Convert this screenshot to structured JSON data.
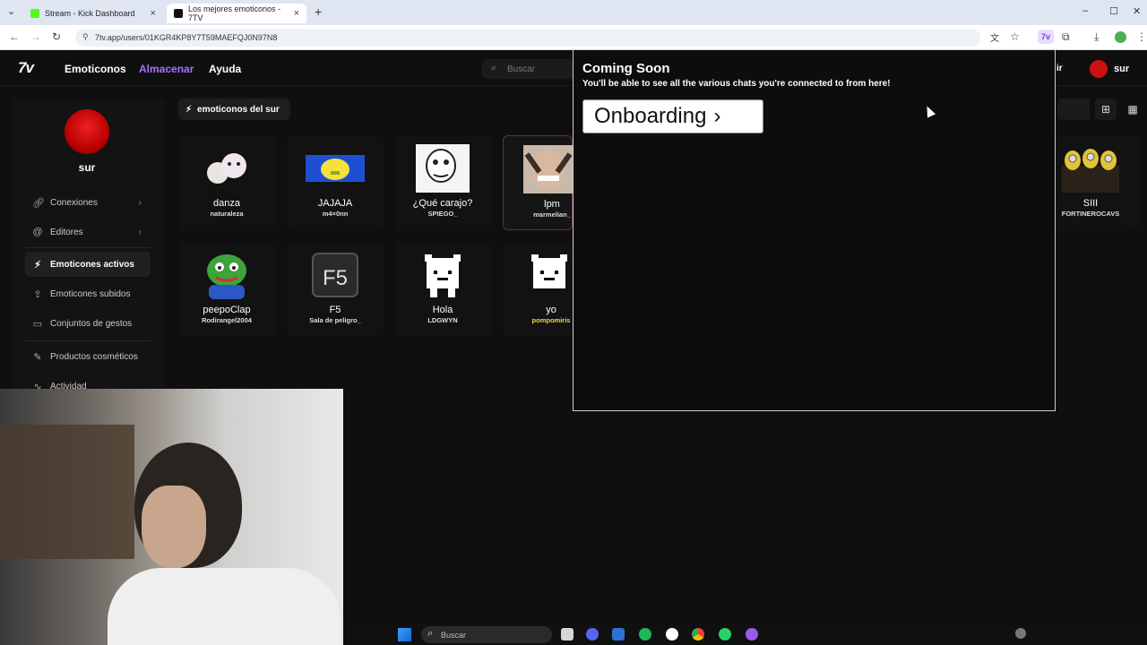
{
  "browser": {
    "tabs": [
      {
        "label": "Stream - Kick Dashboard",
        "active": false,
        "favicon_color": "#53fc18"
      },
      {
        "label": "Los mejores emoticonos - 7TV",
        "active": true,
        "favicon_color": "#111111"
      }
    ],
    "new_tab": "+",
    "url": "7tv.app/users/01KGR4KP8Y7T59MAEFQJ0N97N8",
    "window_controls": [
      "–",
      "☐",
      "✕"
    ]
  },
  "site": {
    "logo": "7v",
    "nav": [
      {
        "label": "Emoticonos"
      },
      {
        "label": "Almacenar"
      },
      {
        "label": "Ayuda"
      }
    ],
    "search_placeholder": "Buscar",
    "header_partial": "ir",
    "header_user": "sur",
    "accent": "#a970ff"
  },
  "sidebar": {
    "username": "sur",
    "items": [
      {
        "label": "Conexiones",
        "icon": "link-icon"
      },
      {
        "label": "Editores",
        "icon": "at-icon"
      },
      {
        "label": "Emoticones activos",
        "icon": "bolt-icon"
      },
      {
        "label": "Emoticones subidos",
        "icon": "upload-icon"
      },
      {
        "label": "Conjuntos de gestos",
        "icon": "folder-icon"
      },
      {
        "label": "Productos cosméticos",
        "icon": "brush-icon"
      },
      {
        "label": "Actividad",
        "icon": "activity-icon"
      }
    ]
  },
  "emote_set": {
    "label": "emoticonos del sur"
  },
  "emotes": [
    {
      "name": "danza",
      "author": "naturaleza"
    },
    {
      "name": "JAJAJA",
      "author": "m4×0nn"
    },
    {
      "name": "¿Qué carajo?",
      "author": "SPIEGO_"
    },
    {
      "name": "lpm",
      "author": "marmelian_"
    },
    {
      "name": "SIII",
      "author": "FORTINEROCAVS"
    },
    {
      "name": "peepoClap",
      "author": "Rodirangel2004"
    },
    {
      "name": "F5",
      "author": "Sala de peligro_"
    },
    {
      "name": "Hola",
      "author": "LDGWYN"
    },
    {
      "name": "yo",
      "author": "pompomiris"
    }
  ],
  "popup": {
    "title": "Coming Soon",
    "subtitle": "You'll be able to see all the various chats you're connected to from here!",
    "button": "Onboarding",
    "button_icon": "chevron-right-icon"
  },
  "taskbar": {
    "search_placeholder": "Buscar"
  }
}
